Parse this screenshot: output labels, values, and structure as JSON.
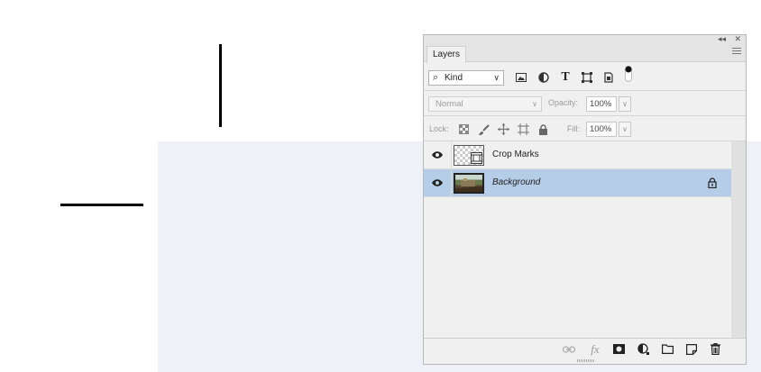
{
  "panel": {
    "tab_label": "Layers",
    "collapse_icon": "collapse-arrows-icon",
    "close_icon": "close-icon",
    "menu_icon": "panel-menu-icon"
  },
  "filter": {
    "kind_label": "Kind",
    "icons": [
      "pixel-filter-icon",
      "adjustment-filter-icon",
      "type-filter-icon",
      "shape-filter-icon",
      "smart-object-filter-icon",
      "filter-toggle-icon"
    ]
  },
  "blend": {
    "mode": "Normal",
    "opacity_label": "Opacity:",
    "opacity_value": "100%"
  },
  "lock": {
    "label": "Lock:",
    "icons": [
      "lock-transparent-icon",
      "lock-pixels-icon",
      "lock-position-icon",
      "lock-artboard-icon",
      "lock-all-icon"
    ],
    "fill_label": "Fill:",
    "fill_value": "100%"
  },
  "layers": [
    {
      "name": "Crop Marks",
      "visible": true,
      "selected": false,
      "locked": false
    },
    {
      "name": "Background",
      "visible": true,
      "selected": true,
      "locked": true
    }
  ],
  "footer_icons": [
    "link-layers-icon",
    "fx-icon",
    "add-mask-icon",
    "new-adjustment-icon",
    "new-group-icon",
    "new-layer-icon",
    "delete-layer-icon"
  ],
  "colors": {
    "selected_layer": "#b6cde7",
    "panel_bg": "#f0f0f0"
  }
}
